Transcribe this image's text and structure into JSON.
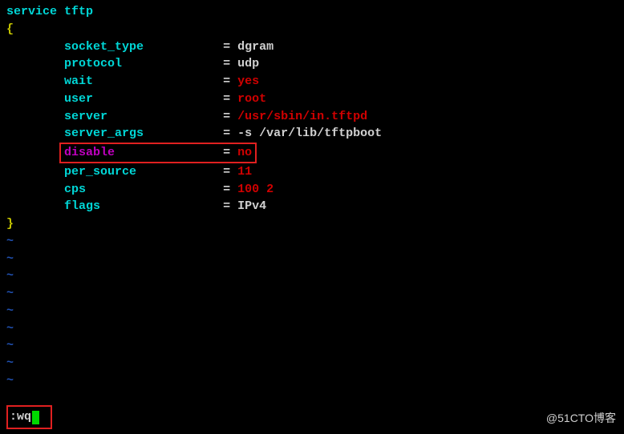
{
  "header": {
    "keyword": "service",
    "name": "tftp"
  },
  "braces": {
    "open": "{",
    "close": "}"
  },
  "rows": [
    {
      "key": "socket_type",
      "eq": "=",
      "val": "dgram",
      "vclass": "c-white"
    },
    {
      "key": "protocol",
      "eq": "=",
      "val": "udp",
      "vclass": "c-white"
    },
    {
      "key": "wait",
      "eq": "=",
      "val": "yes",
      "vclass": "c-red"
    },
    {
      "key": "user",
      "eq": "=",
      "val": "root",
      "vclass": "c-red"
    },
    {
      "key": "server",
      "eq": "=",
      "val": "/usr/sbin/in.tftpd",
      "vclass": "c-red"
    },
    {
      "key": "server_args",
      "eq": "=",
      "val": "-s /var/lib/tftpboot",
      "vclass": "c-white"
    },
    {
      "key": "disable",
      "eq": "=",
      "val": "no",
      "vclass": "c-red",
      "highlight": true,
      "kclass": "c-magenta"
    },
    {
      "key": "per_source",
      "eq": "=",
      "val": "11",
      "vclass": "c-red"
    },
    {
      "key": "cps",
      "eq": "=",
      "val": "100 2",
      "vclass": "c-red"
    },
    {
      "key": "flags",
      "eq": "=",
      "val": "IPv4",
      "vclass": "c-white"
    }
  ],
  "tilde": "~",
  "cmd": {
    "colon": ":",
    "text": "wq"
  },
  "watermark": "@51CTO博客"
}
